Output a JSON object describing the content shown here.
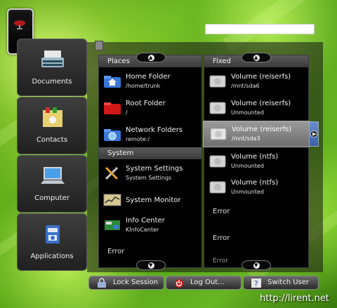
{
  "sidebar": {
    "items": [
      {
        "label": "Documents",
        "icon": "typewriter-icon"
      },
      {
        "label": "Contacts",
        "icon": "address-book-icon"
      },
      {
        "label": "Computer",
        "icon": "laptop-icon"
      },
      {
        "label": "Applications",
        "icon": "applications-icon"
      }
    ]
  },
  "places": {
    "header": "Places",
    "items": [
      {
        "title": "Home Folder",
        "sub": "/home/trunk",
        "icon": "home-folder-icon"
      },
      {
        "title": "Root Folder",
        "sub": "/",
        "icon": "red-folder-icon"
      },
      {
        "title": "Network Folders",
        "sub": "remote:/",
        "icon": "network-folder-icon"
      }
    ]
  },
  "system": {
    "header": "System",
    "items": [
      {
        "title": "System Settings",
        "sub": "System Settings",
        "icon": "tools-icon"
      },
      {
        "title": "System Monitor",
        "icon": "monitor-icon"
      },
      {
        "title": "Info Center",
        "sub": "KInfoCenter",
        "icon": "info-board-icon"
      }
    ],
    "error": "Error"
  },
  "fixed": {
    "header": "Fixed",
    "items": [
      {
        "title": "Volume (reiserfs)",
        "sub": "/mnt/sda6"
      },
      {
        "title": "Volume (reiserfs)",
        "sub": "Unmounted"
      },
      {
        "title": "Volume (reiserfs)",
        "sub": "/mnt/sda3"
      },
      {
        "title": "Volume (ntfs)",
        "sub": "Unmounted"
      },
      {
        "title": "Volume (ntfs)",
        "sub": "Unmounted"
      }
    ],
    "errors": [
      "Error",
      "Error",
      "Error"
    ]
  },
  "bottom_bar": {
    "lock": "Lock Session",
    "logout": "Log Out...",
    "switch": "Switch User"
  },
  "watermark": "http://lirent.net",
  "colors": {
    "selection": "#8a8a8a",
    "expand_accent": "#4a6fb8",
    "folder_red": "#d01818",
    "folder_blue": "#3a78d8"
  }
}
